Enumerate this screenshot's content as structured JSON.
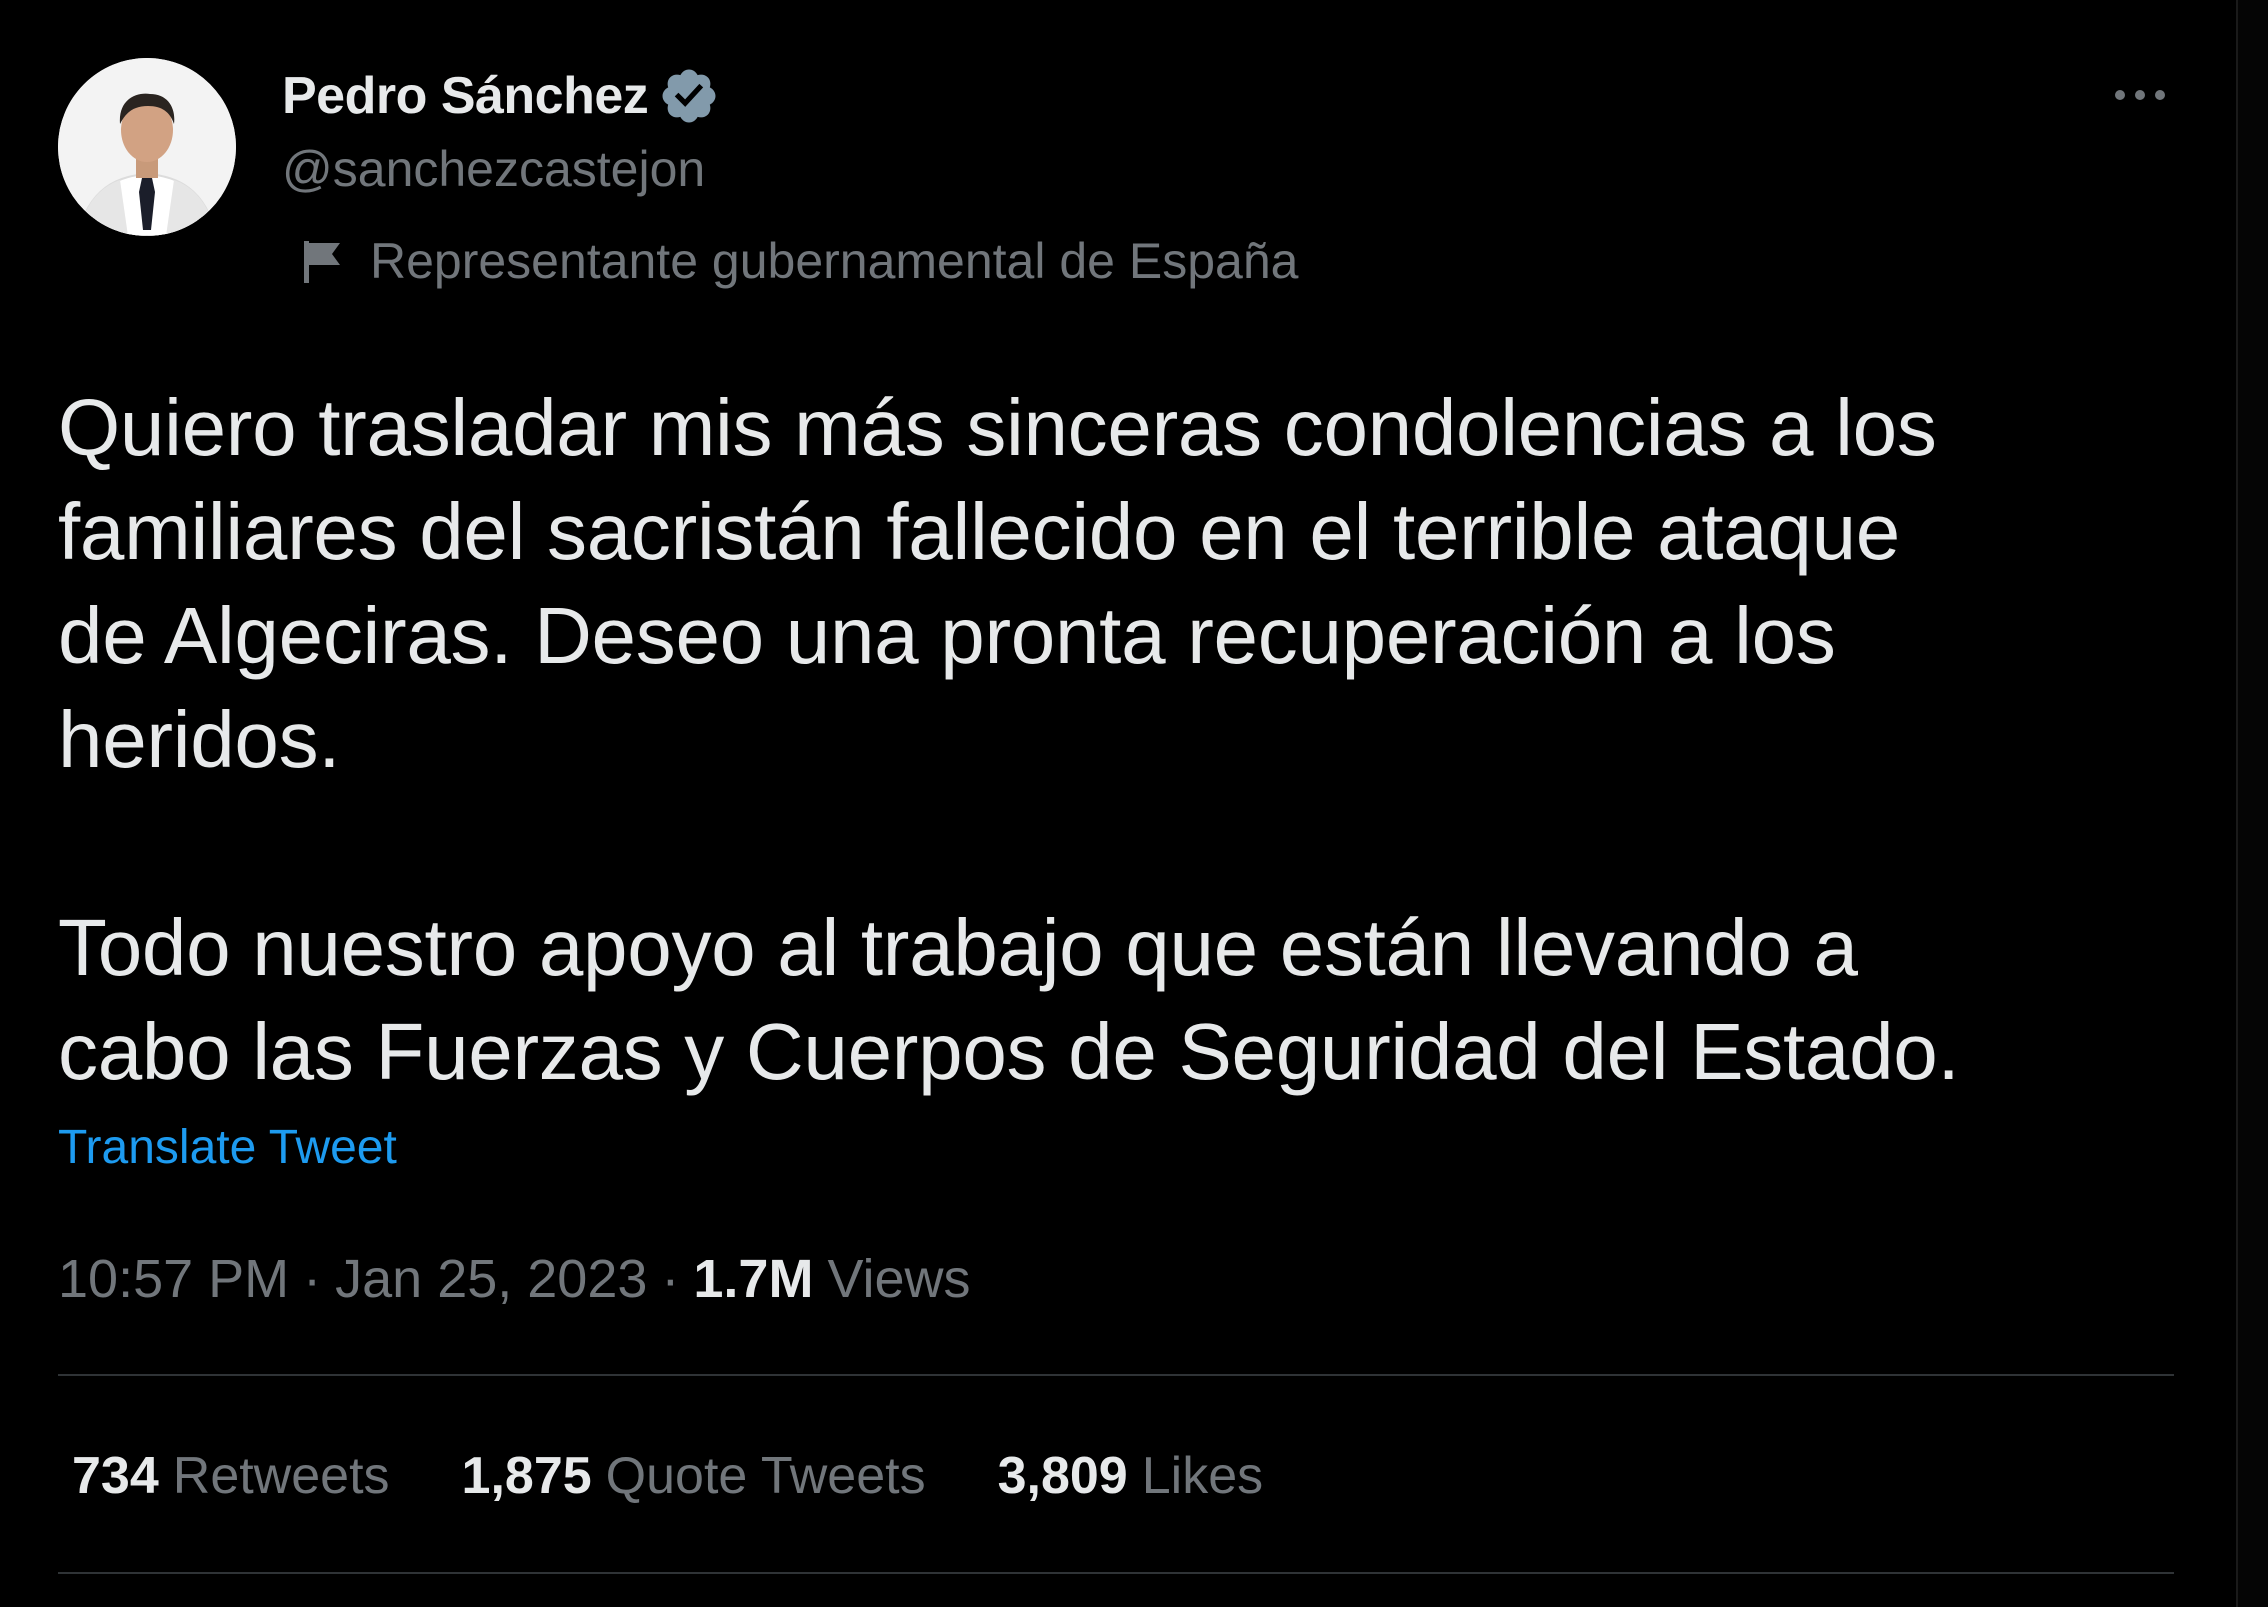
{
  "author": {
    "name": "Pedro Sánchez",
    "handle": "@sanchezcastejon",
    "label": "Representante gubernamental de España"
  },
  "tweet": {
    "text": "Quiero trasladar mis más sinceras condolencias a los\nfamiliares del sacristán fallecido en el terrible ataque\nde Algeciras. Deseo una pronta recuperación a los\nheridos.\n\nTodo nuestro apoyo al trabajo que están llevando a\ncabo las Fuerzas y Cuerpos de Seguridad del Estado.",
    "translate_label": "Translate Tweet"
  },
  "meta": {
    "time": "10:57 PM",
    "date": "Jan 25, 2023",
    "separator": "·",
    "views_count": "1.7M",
    "views_label": "Views"
  },
  "stats": [
    {
      "count": "734",
      "label": "Retweets"
    },
    {
      "count": "1,875",
      "label": "Quote Tweets"
    },
    {
      "count": "3,809",
      "label": "Likes"
    }
  ],
  "icons": {
    "verified": "verified-badge-icon",
    "flag": "flag-icon",
    "more": "more-options-icon"
  },
  "colors": {
    "background": "#000000",
    "text_primary": "#e7e9ea",
    "text_secondary": "#71767b",
    "link": "#1d9bf0",
    "divider": "#2f3336",
    "verified_badge": "#829aab"
  }
}
